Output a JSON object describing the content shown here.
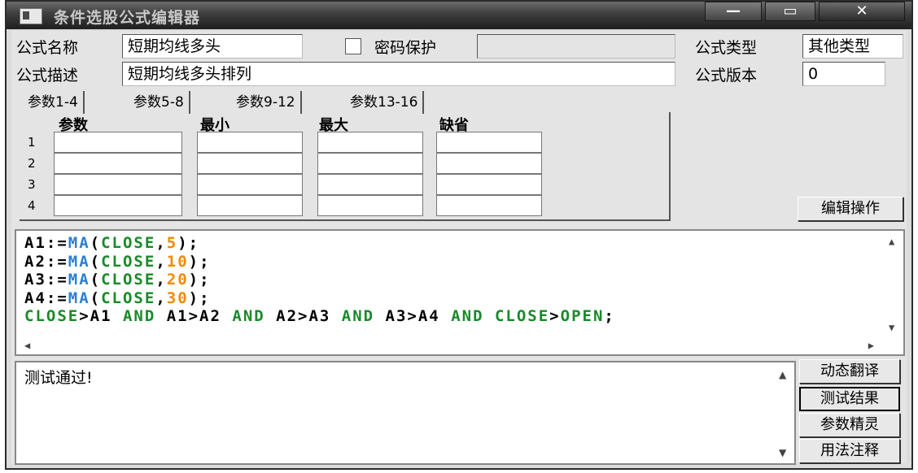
{
  "window": {
    "title": "条件选股公式编辑器",
    "min_glyph": "—",
    "max_glyph": "▭",
    "close_glyph": "✕"
  },
  "form": {
    "name_label": "公式名称",
    "name_value": "短期均线多头",
    "password_label": "密码保护",
    "password_checked": false,
    "password_value": "",
    "type_label": "公式类型",
    "type_value": "其他类型",
    "desc_label": "公式描述",
    "desc_value": "短期均线多头排列",
    "version_label": "公式版本",
    "version_value": "0"
  },
  "tabs": [
    {
      "label": "参数1-4",
      "active": true
    },
    {
      "label": "参数5-8",
      "active": false
    },
    {
      "label": "参数9-12",
      "active": false
    },
    {
      "label": "参数13-16",
      "active": false
    }
  ],
  "params": {
    "headers": [
      "参数",
      "最小",
      "最大",
      "缺省"
    ],
    "rows": [
      "1",
      "2",
      "3",
      "4"
    ]
  },
  "buttons": {
    "edit_ops": "编辑操作",
    "dynamic_translate": "动态翻译",
    "test_result": "测试结果",
    "param_wizard": "参数精灵",
    "usage_notes": "用法注释"
  },
  "code_colors": {
    "default": "#000000",
    "function": "#2b7fd4",
    "keyword": "#1a8a2a",
    "number": "#f08a00"
  },
  "code_lines": [
    [
      {
        "t": "A1:=",
        "c": "default"
      },
      {
        "t": "MA",
        "c": "function"
      },
      {
        "t": "(",
        "c": "default"
      },
      {
        "t": "CLOSE",
        "c": "keyword"
      },
      {
        "t": ",",
        "c": "default"
      },
      {
        "t": "5",
        "c": "number"
      },
      {
        "t": ");",
        "c": "default"
      }
    ],
    [
      {
        "t": "A2:=",
        "c": "default"
      },
      {
        "t": "MA",
        "c": "function"
      },
      {
        "t": "(",
        "c": "default"
      },
      {
        "t": "CLOSE",
        "c": "keyword"
      },
      {
        "t": ",",
        "c": "default"
      },
      {
        "t": "10",
        "c": "number"
      },
      {
        "t": ");",
        "c": "default"
      }
    ],
    [
      {
        "t": "A3:=",
        "c": "default"
      },
      {
        "t": "MA",
        "c": "function"
      },
      {
        "t": "(",
        "c": "default"
      },
      {
        "t": "CLOSE",
        "c": "keyword"
      },
      {
        "t": ",",
        "c": "default"
      },
      {
        "t": "20",
        "c": "number"
      },
      {
        "t": ");",
        "c": "default"
      }
    ],
    [
      {
        "t": "A4:=",
        "c": "default"
      },
      {
        "t": "MA",
        "c": "function"
      },
      {
        "t": "(",
        "c": "default"
      },
      {
        "t": "CLOSE",
        "c": "keyword"
      },
      {
        "t": ",",
        "c": "default"
      },
      {
        "t": "30",
        "c": "number"
      },
      {
        "t": ");",
        "c": "default"
      }
    ],
    [
      {
        "t": "CLOSE",
        "c": "keyword"
      },
      {
        "t": ">A1 ",
        "c": "default"
      },
      {
        "t": "AND",
        "c": "keyword"
      },
      {
        "t": " A1>A2 ",
        "c": "default"
      },
      {
        "t": "AND",
        "c": "keyword"
      },
      {
        "t": " A2>A3 ",
        "c": "default"
      },
      {
        "t": "AND",
        "c": "keyword"
      },
      {
        "t": " A3>A4 ",
        "c": "default"
      },
      {
        "t": "AND",
        "c": "keyword"
      },
      {
        "t": " ",
        "c": "default"
      },
      {
        "t": "CLOSE",
        "c": "keyword"
      },
      {
        "t": ">",
        "c": "default"
      },
      {
        "t": "OPEN",
        "c": "keyword"
      },
      {
        "t": ";",
        "c": "default"
      }
    ]
  ],
  "output": {
    "text": "测试通过!"
  }
}
